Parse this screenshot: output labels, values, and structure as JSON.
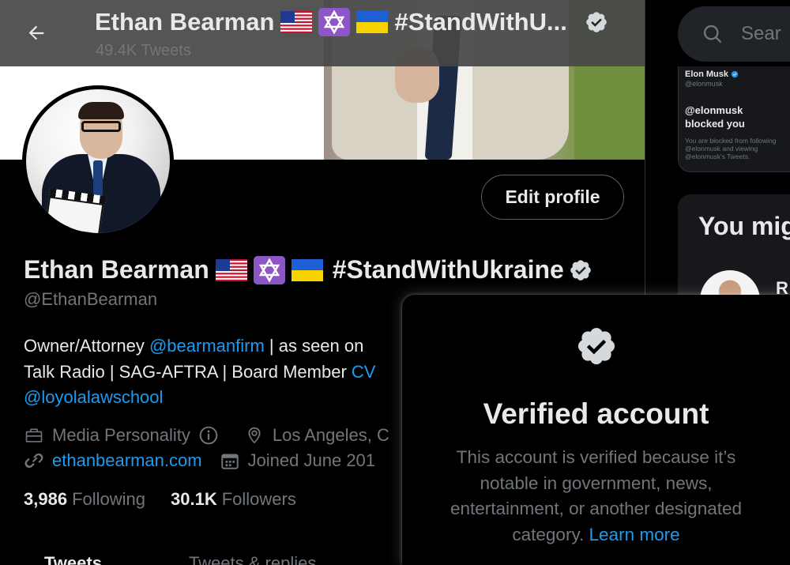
{
  "header": {
    "title": "Ethan Bearman",
    "title_suffix": "#StandWithU...",
    "tweet_count": "49.4K Tweets"
  },
  "profile": {
    "name": "Ethan Bearman",
    "name_suffix": "#StandWithUkraine",
    "handle": "@EthanBearman",
    "edit_button": "Edit profile",
    "bio": {
      "line1_text": "Owner/Attorney ",
      "line1_link": "@bearmanfirm",
      "line1_tail": " | as seen on",
      "line2_text": "Talk Radio | SAG-AFTRA | Board Member ",
      "line2_link": "CV",
      "line3_link": "@loyolalawschool"
    },
    "category": "Media Personality",
    "location": "Los Angeles, C",
    "website": "ethanbearman.com",
    "joined": "Joined June 201",
    "following_count": "3,986",
    "following_label": "Following",
    "followers_count": "30.1K",
    "followers_label": "Followers"
  },
  "tabs": [
    "Tweets",
    "Tweets & replies"
  ],
  "sidebar": {
    "search_placeholder": "Sear",
    "embed": {
      "name": "Elon Musk",
      "handle": "@elonmusk",
      "blocked_title": "@elonmusk blocked you",
      "blocked_desc": "You are blocked from following @elonmusk and viewing @elonmusk's Tweets."
    },
    "suggest_title": "You mig",
    "suggest_name": "R"
  },
  "popover": {
    "title": "Verified account",
    "text": "This account is verified because it’s notable in government, news, entertainment, or another designated category. ",
    "link": "Learn more"
  },
  "icons": {
    "back": "arrow-left-icon",
    "verified": "verified-badge-icon",
    "briefcase": "briefcase-icon",
    "info": "info-icon",
    "location": "map-pin-icon",
    "link": "link-icon",
    "calendar": "calendar-icon",
    "search": "search-icon"
  },
  "colors": {
    "accent": "#1d9bf0",
    "text": "#e7e9ea",
    "muted": "#71767b",
    "background": "#000000"
  }
}
